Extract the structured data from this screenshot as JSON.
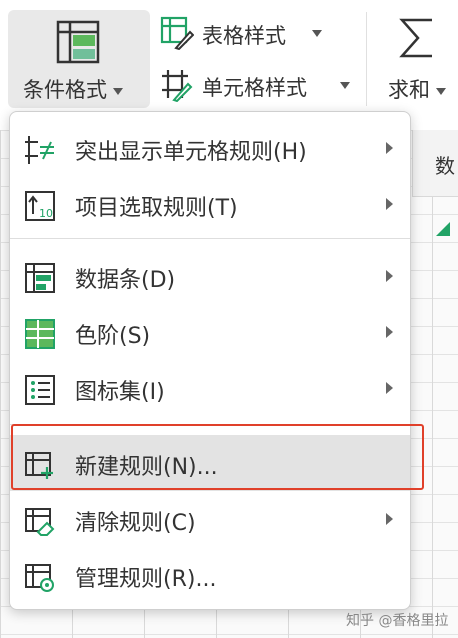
{
  "ribbon": {
    "conditional_format_label": "条件格式",
    "table_style_label": "表格样式",
    "cell_style_label": "单元格样式",
    "sum_label": "求和"
  },
  "sheet": {
    "column_header_text": "数"
  },
  "menu": {
    "items": [
      {
        "label": "突出显示单元格规则(H)",
        "icon": "highlight-cells-icon",
        "has_submenu": true
      },
      {
        "label": "项目选取规则(T)",
        "icon": "top-bottom-rules-icon",
        "has_submenu": true
      },
      {
        "label": "数据条(D)",
        "icon": "data-bars-icon",
        "has_submenu": true
      },
      {
        "label": "色阶(S)",
        "icon": "color-scales-icon",
        "has_submenu": true
      },
      {
        "label": "图标集(I)",
        "icon": "icon-sets-icon",
        "has_submenu": true
      },
      {
        "label": "新建规则(N)...",
        "icon": "new-rule-icon",
        "has_submenu": false,
        "highlighted": true
      },
      {
        "label": "清除规则(C)",
        "icon": "clear-rules-icon",
        "has_submenu": true
      },
      {
        "label": "管理规则(R)...",
        "icon": "manage-rules-icon",
        "has_submenu": false
      }
    ]
  },
  "watermark": "知乎 @香格里拉",
  "colors": {
    "accent_green": "#21a366",
    "highlight_box": "#e0402a",
    "hover_bg": "#e3e3e3"
  }
}
